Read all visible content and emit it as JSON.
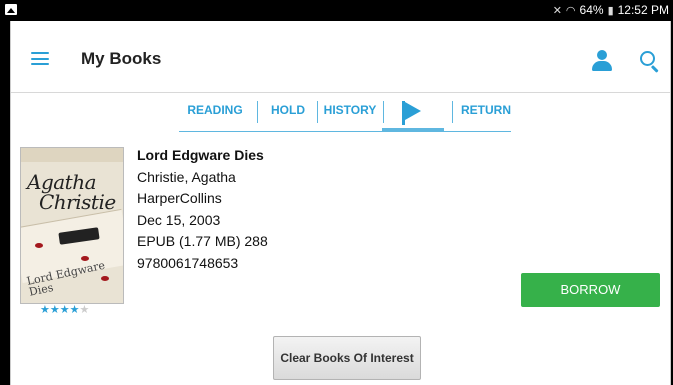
{
  "status_bar": {
    "mute_icon": "mute-icon",
    "wifi_icon": "wifi-icon",
    "battery_percent": "64%",
    "battery_icon": "battery-icon",
    "time": "12:52 PM"
  },
  "toolbar": {
    "title": "My Books",
    "menu_icon": "menu-icon",
    "user_icon": "user-icon",
    "search_icon": "search-icon"
  },
  "tabs": [
    {
      "label": "READING"
    },
    {
      "label": "HOLD"
    },
    {
      "label": "HISTORY"
    },
    {
      "label": "",
      "icon": "flag-icon",
      "active": true
    },
    {
      "label": "RETURN"
    }
  ],
  "book": {
    "cover_script_line1": "Agatha",
    "cover_script_line2": "Christie",
    "cover_subtitle": "Lord Edgware Dies",
    "title": "Lord Edgware Dies",
    "author": "Christie, Agatha",
    "publisher": "HarperCollins",
    "date": "Dec 15, 2003",
    "format": "EPUB (1.77 MB) 288",
    "isbn": "9780061748653",
    "rating": 4,
    "rating_max": 5
  },
  "actions": {
    "borrow_label": "BORROW",
    "clear_label": "Clear Books Of Interest"
  },
  "colors": {
    "accent": "#2a9fd6",
    "borrow": "#36b14a"
  }
}
